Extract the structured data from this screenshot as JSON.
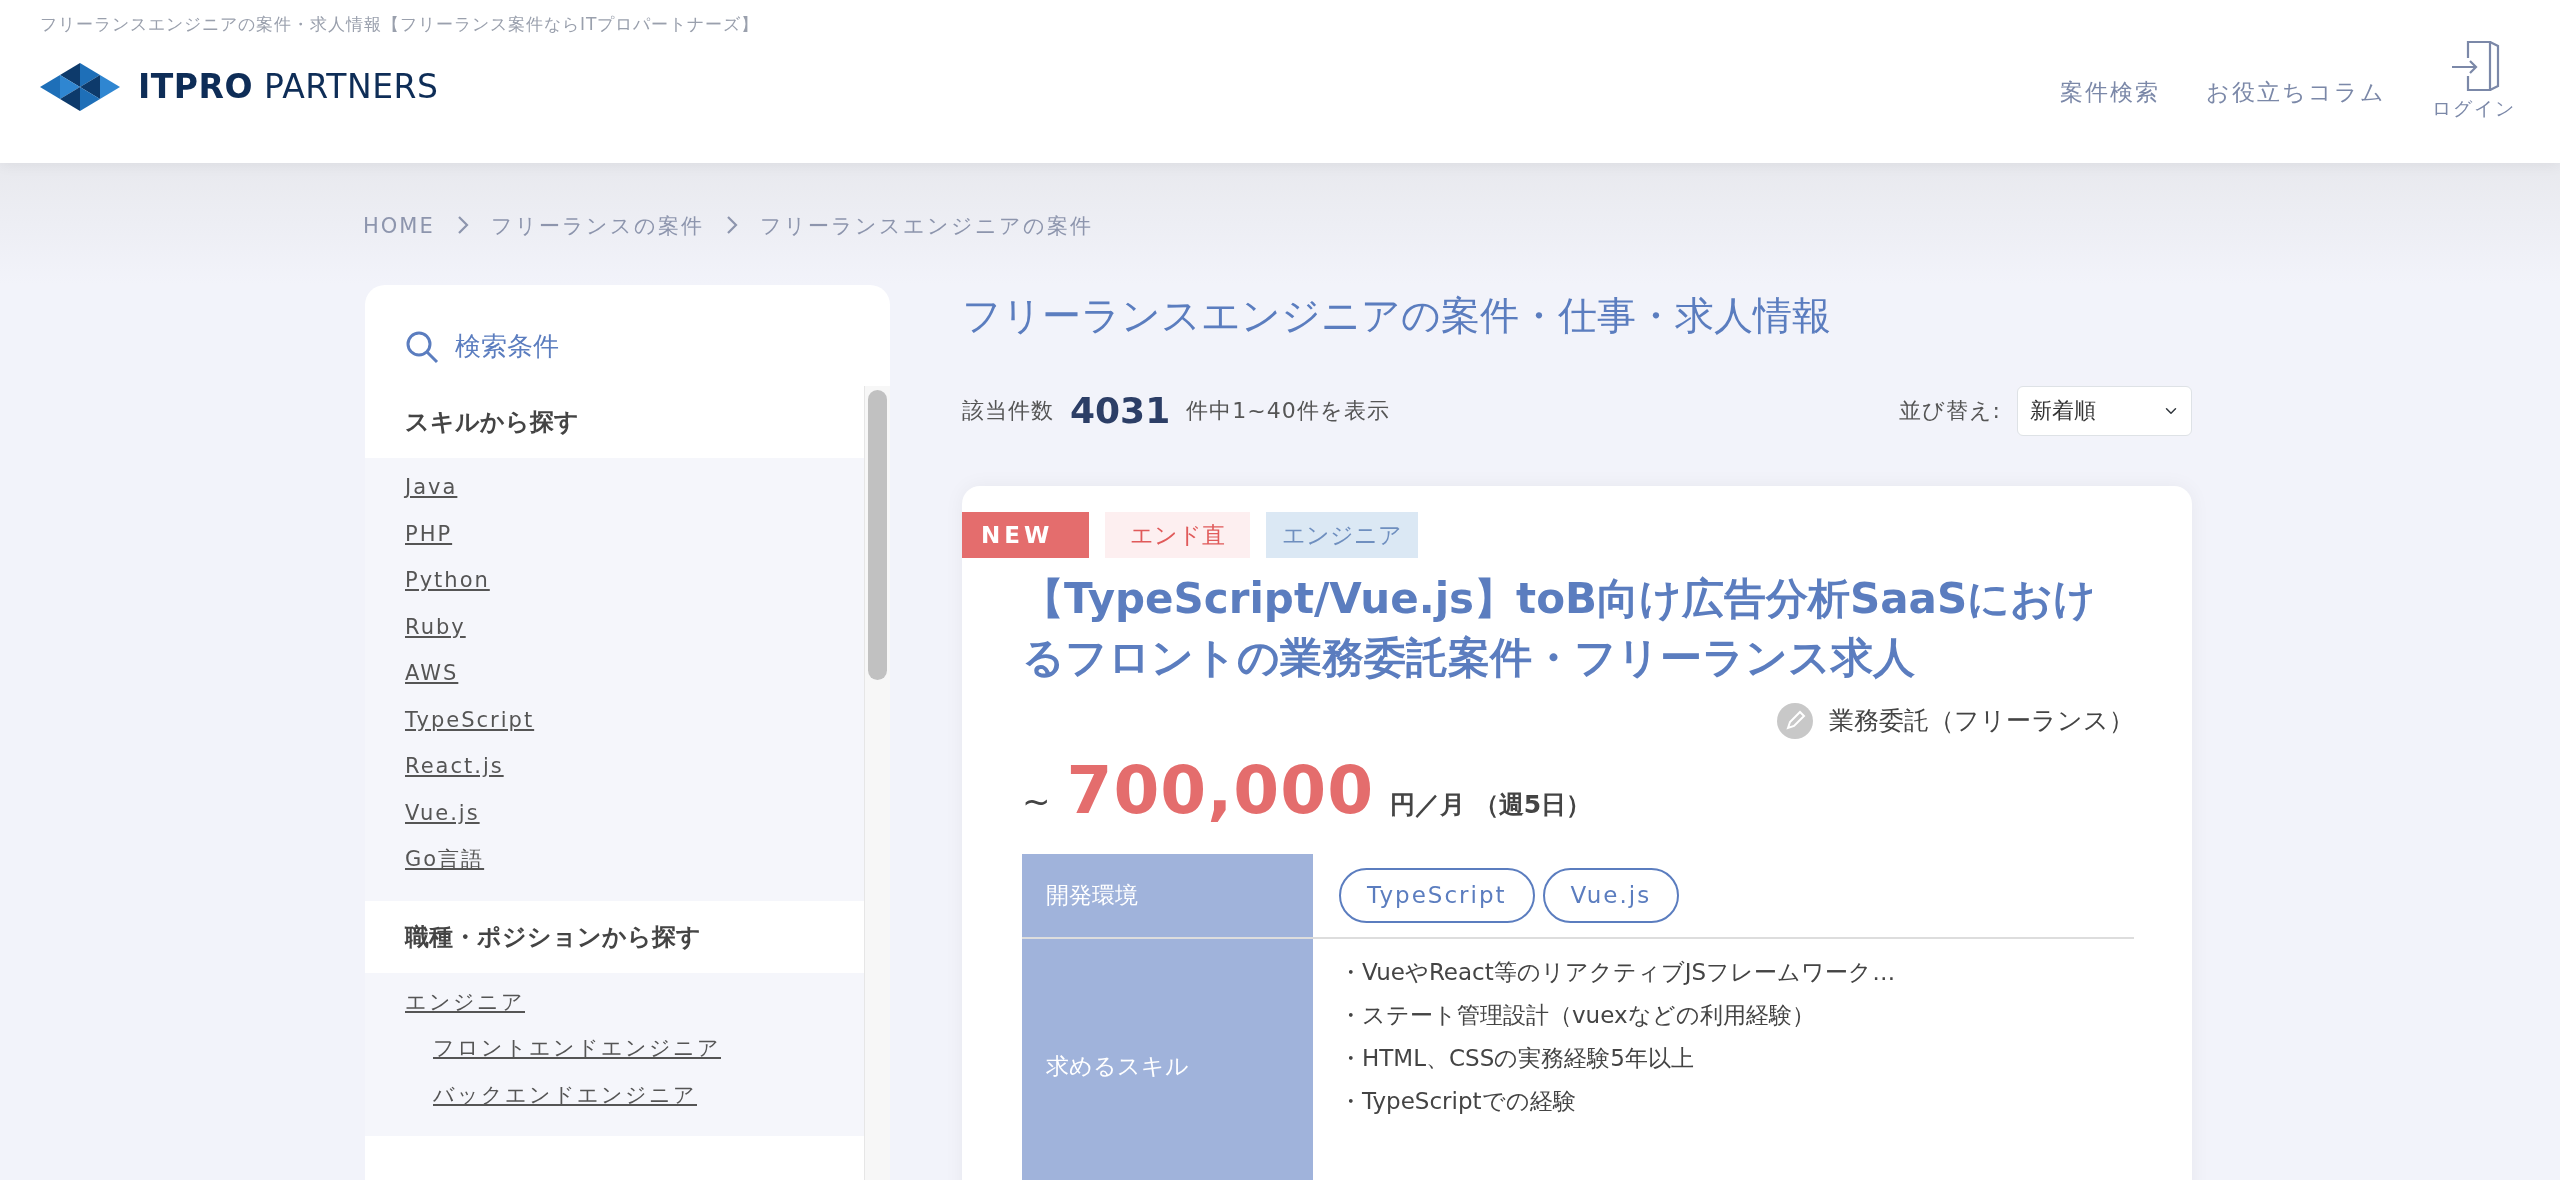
{
  "site_tagline": "フリーランスエンジニアの案件・求人情報【フリーランス案件ならITプロパートナーズ】",
  "logo": {
    "text": "**ITPRO** PARTNERS"
  },
  "nav": [
    {
      "label": "案件検索",
      "kind": "link"
    },
    {
      "label": "お役立ちコラム",
      "kind": "link"
    },
    {
      "label": "ログイン",
      "kind": "login"
    }
  ],
  "breadcrumb": [
    "HOME",
    "フリーランスの案件",
    "フリーランスエンジニアの案件"
  ],
  "sidebar": {
    "title": "検索条件",
    "sections": [
      {
        "heading": "スキルから探す",
        "items": [
          {
            "label": "Java"
          },
          {
            "label": "PHP"
          },
          {
            "label": "Python"
          },
          {
            "label": "Ruby"
          },
          {
            "label": "AWS"
          },
          {
            "label": "TypeScript"
          },
          {
            "label": "React.js"
          },
          {
            "label": "Vue.js"
          },
          {
            "label": "Go言語"
          }
        ]
      },
      {
        "heading": "職種・ポジションから探す",
        "items": [
          {
            "label": "エンジニア",
            "children": [
              {
                "label": "フロントエンドエンジニア"
              },
              {
                "label": "バックエンドエンジニア"
              }
            ]
          }
        ]
      }
    ]
  },
  "results": {
    "title": "フリーランスエンジニアの案件・仕事・求人情報",
    "count_label": "該当件数",
    "count": "4031",
    "count_suffix": "件中1~40件を表示",
    "sort_label": "並び替え:",
    "sort_value": "新着順"
  },
  "jobs": [
    {
      "badges": [
        {
          "label": "NEW",
          "kind": "ribbon"
        },
        {
          "label": "エンド直",
          "kind": "end"
        },
        {
          "label": "エンジニア",
          "kind": "role"
        }
      ],
      "title": "【TypeScript/Vue.js】toB向け広告分析SaaSにおけるフロントの業務委託案件・フリーランス求人",
      "contract": "業務委託（フリーランス）",
      "salary_prefix": "~",
      "salary": "700,000",
      "salary_unit": "円／月 （週5日）",
      "details": [
        {
          "label": "開発環境",
          "kind": "tags",
          "values": [
            "TypeScript",
            "Vue.js"
          ]
        },
        {
          "label": "求めるスキル",
          "kind": "bullets",
          "values": [
            "・VueやReact等のリアクティブJSフレームワーク…",
            "・ステート管理設計（vuexなどの利用経験）",
            "・HTML、CSSの実務経験5年以上",
            "・TypeScriptでの経験"
          ]
        }
      ]
    }
  ]
}
